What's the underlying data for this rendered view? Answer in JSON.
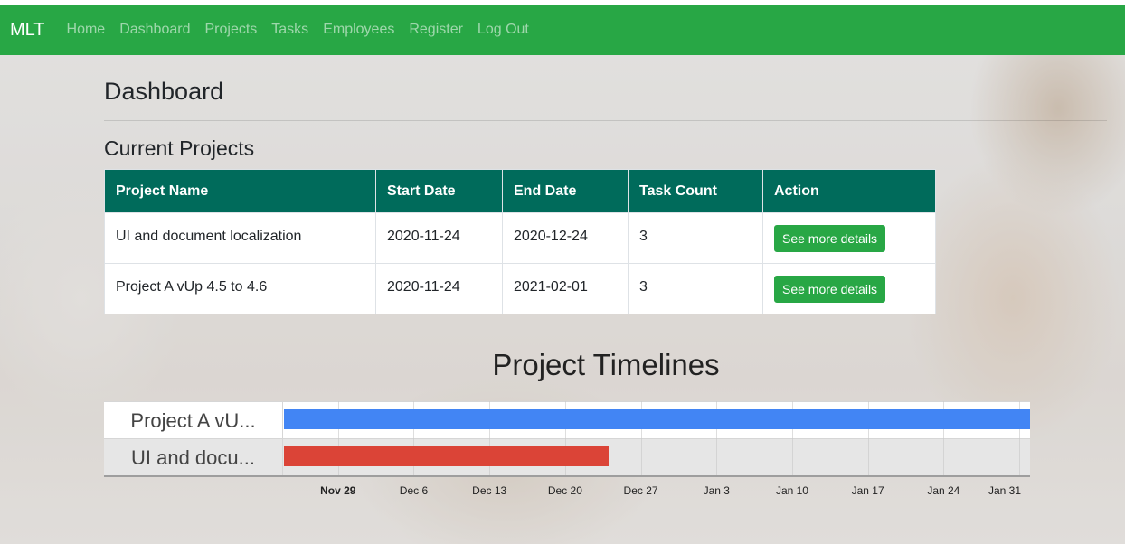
{
  "navbar": {
    "brand": "MLT",
    "links": [
      "Home",
      "Dashboard",
      "Projects",
      "Tasks",
      "Employees",
      "Register",
      "Log Out"
    ],
    "bg_color": "#28a745"
  },
  "page": {
    "title": "Dashboard",
    "section_title": "Current Projects"
  },
  "projects_table": {
    "headers": [
      "Project Name",
      "Start Date",
      "End Date",
      "Task Count",
      "Action"
    ],
    "header_color": "#006b5b",
    "rows": [
      {
        "name": "UI and document localization",
        "start": "2020-11-24",
        "end": "2020-12-24",
        "tasks": "3",
        "action": "See more details"
      },
      {
        "name": "Project A vUp 4.5 to 4.6",
        "start": "2020-11-24",
        "end": "2021-02-01",
        "tasks": "3",
        "action": "See more details"
      }
    ]
  },
  "chart_data": {
    "type": "timeline",
    "title": "Project Timelines",
    "rows": [
      {
        "label": "Project A vU...",
        "full_name": "Project A vUp 4.5 to 4.6",
        "start": "2020-11-24",
        "end": "2021-02-01",
        "color": "#4285f4"
      },
      {
        "label": "UI and docu...",
        "full_name": "UI and document localization",
        "start": "2020-11-24",
        "end": "2020-12-24",
        "color": "#db4437"
      }
    ],
    "x_range": [
      "2020-11-24",
      "2021-02-01"
    ],
    "ticks": [
      {
        "label": "Nov 29",
        "date": "2020-11-29",
        "major": true
      },
      {
        "label": "Dec 6",
        "date": "2020-12-06",
        "major": false
      },
      {
        "label": "Dec 13",
        "date": "2020-12-13",
        "major": false
      },
      {
        "label": "Dec 20",
        "date": "2020-12-20",
        "major": false
      },
      {
        "label": "Dec 27",
        "date": "2020-12-27",
        "major": false
      },
      {
        "label": "Jan 3",
        "date": "2021-01-03",
        "major": false
      },
      {
        "label": "Jan 10",
        "date": "2021-01-10",
        "major": false
      },
      {
        "label": "Jan 17",
        "date": "2021-01-17",
        "major": false
      },
      {
        "label": "Jan 24",
        "date": "2021-01-24",
        "major": false
      },
      {
        "label": "Jan 31",
        "date": "2021-01-31",
        "major": false
      }
    ]
  }
}
